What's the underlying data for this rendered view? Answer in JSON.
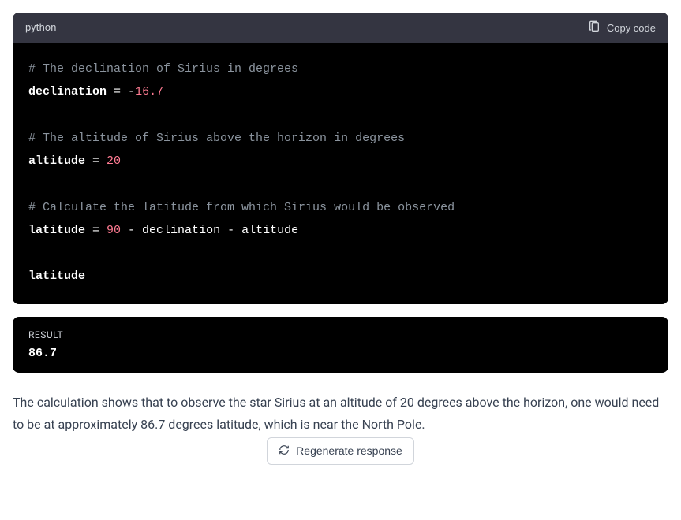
{
  "code_block": {
    "language": "python",
    "copy_label": "Copy code",
    "lines": [
      {
        "type": "comment",
        "text": "# The declination of Sirius in degrees"
      },
      {
        "type": "assign",
        "var": "declination",
        "eq": " = ",
        "prefix": "-",
        "num": "16.7"
      },
      {
        "type": "blank",
        "text": ""
      },
      {
        "type": "comment",
        "text": "# The altitude of Sirius above the horizon in degrees"
      },
      {
        "type": "assign",
        "var": "altitude",
        "eq": " = ",
        "prefix": "",
        "num": "20"
      },
      {
        "type": "blank",
        "text": ""
      },
      {
        "type": "comment",
        "text": "# Calculate the latitude from which Sirius would be observed"
      },
      {
        "type": "expr",
        "var": "latitude",
        "mid": " = ",
        "num": "90",
        "rest": " - declination - altitude"
      },
      {
        "type": "blank",
        "text": ""
      },
      {
        "type": "var",
        "var": "latitude"
      }
    ]
  },
  "result": {
    "label": "RESULT",
    "value": "86.7"
  },
  "explanation": "The calculation shows that to observe the star Sirius at an altitude of 20 degrees above the horizon, one would need to be at approximately 86.7 degrees latitude, which is near the North Pole.",
  "regenerate_label": "Regenerate response"
}
